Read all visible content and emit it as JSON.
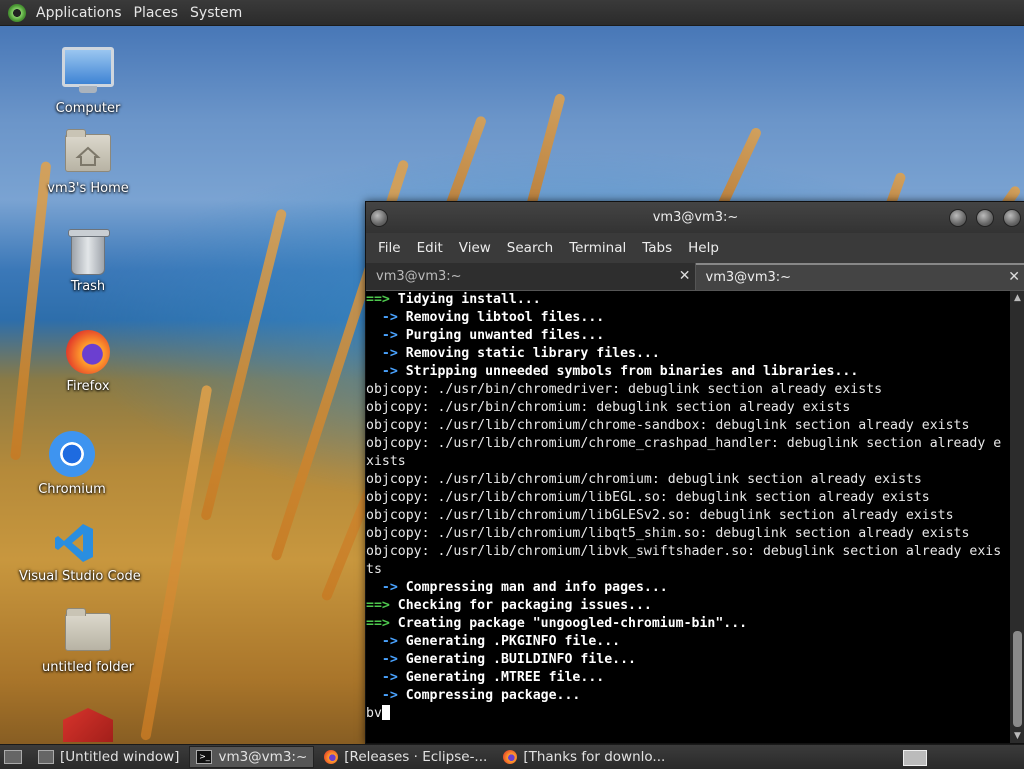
{
  "top_panel": {
    "menus": [
      "Applications",
      "Places",
      "System"
    ]
  },
  "desktop": {
    "icons": [
      {
        "label": "Computer",
        "icon": "computer-icon"
      },
      {
        "label": "vm3's Home",
        "icon": "home-folder-icon"
      },
      {
        "label": "Trash",
        "icon": "trash-icon"
      },
      {
        "label": "Firefox",
        "icon": "firefox-icon"
      },
      {
        "label": "Chromium",
        "icon": "chromium-icon"
      },
      {
        "label": "Visual Studio Code",
        "icon": "vscode-icon"
      },
      {
        "label": "untitled folder",
        "icon": "folder-icon"
      }
    ]
  },
  "terminal": {
    "title": "vm3@vm3:~",
    "menu": [
      "File",
      "Edit",
      "View",
      "Search",
      "Terminal",
      "Tabs",
      "Help"
    ],
    "tabs": [
      {
        "label": "vm3@vm3:~",
        "active": false
      },
      {
        "label": "vm3@vm3:~",
        "active": true
      }
    ],
    "lines": [
      {
        "p": "==> ",
        "t": "Tidying install...",
        "k": "g"
      },
      {
        "p": "  -> ",
        "t": "Removing libtool files...",
        "k": "b"
      },
      {
        "p": "  -> ",
        "t": "Purging unwanted files...",
        "k": "b"
      },
      {
        "p": "  -> ",
        "t": "Removing static library files...",
        "k": "b"
      },
      {
        "p": "  -> ",
        "t": "Stripping unneeded symbols from binaries and libraries...",
        "k": "b"
      },
      {
        "p": "",
        "t": "objcopy: ./usr/bin/chromedriver: debuglink section already exists",
        "k": "n"
      },
      {
        "p": "",
        "t": "objcopy: ./usr/bin/chromium: debuglink section already exists",
        "k": "n"
      },
      {
        "p": "",
        "t": "objcopy: ./usr/lib/chromium/chrome-sandbox: debuglink section already exists",
        "k": "n"
      },
      {
        "p": "",
        "t": "objcopy: ./usr/lib/chromium/chrome_crashpad_handler: debuglink section already e",
        "k": "n"
      },
      {
        "p": "",
        "t": "xists",
        "k": "n"
      },
      {
        "p": "",
        "t": "objcopy: ./usr/lib/chromium/chromium: debuglink section already exists",
        "k": "n"
      },
      {
        "p": "",
        "t": "objcopy: ./usr/lib/chromium/libEGL.so: debuglink section already exists",
        "k": "n"
      },
      {
        "p": "",
        "t": "objcopy: ./usr/lib/chromium/libGLESv2.so: debuglink section already exists",
        "k": "n"
      },
      {
        "p": "",
        "t": "objcopy: ./usr/lib/chromium/libqt5_shim.so: debuglink section already exists",
        "k": "n"
      },
      {
        "p": "",
        "t": "objcopy: ./usr/lib/chromium/libvk_swiftshader.so: debuglink section already exis",
        "k": "n"
      },
      {
        "p": "",
        "t": "ts",
        "k": "n"
      },
      {
        "p": "  -> ",
        "t": "Compressing man and info pages...",
        "k": "b"
      },
      {
        "p": "==> ",
        "t": "Checking for packaging issues...",
        "k": "g"
      },
      {
        "p": "==> ",
        "t": "Creating package \"ungoogled-chromium-bin\"...",
        "k": "g"
      },
      {
        "p": "  -> ",
        "t": "Generating .PKGINFO file...",
        "k": "b"
      },
      {
        "p": "  -> ",
        "t": "Generating .BUILDINFO file...",
        "k": "b"
      },
      {
        "p": "  -> ",
        "t": "Generating .MTREE file...",
        "k": "b"
      },
      {
        "p": "  -> ",
        "t": "Compressing package...",
        "k": "b"
      }
    ],
    "prompt_input": "bv"
  },
  "taskbar": {
    "items": [
      {
        "label": "[Untitled window]",
        "icon": "window-icon",
        "active": false
      },
      {
        "label": "vm3@vm3:~",
        "icon": "terminal-icon",
        "active": true
      },
      {
        "label": "[Releases · Eclipse-...",
        "icon": "firefox-icon",
        "active": false
      },
      {
        "label": "[Thanks for downlo...",
        "icon": "firefox-icon",
        "active": false
      }
    ]
  },
  "colors": {
    "arrow_blue": "#4aa3ff",
    "arrow_green": "#4ec94e",
    "terminal_bg": "#000000"
  }
}
